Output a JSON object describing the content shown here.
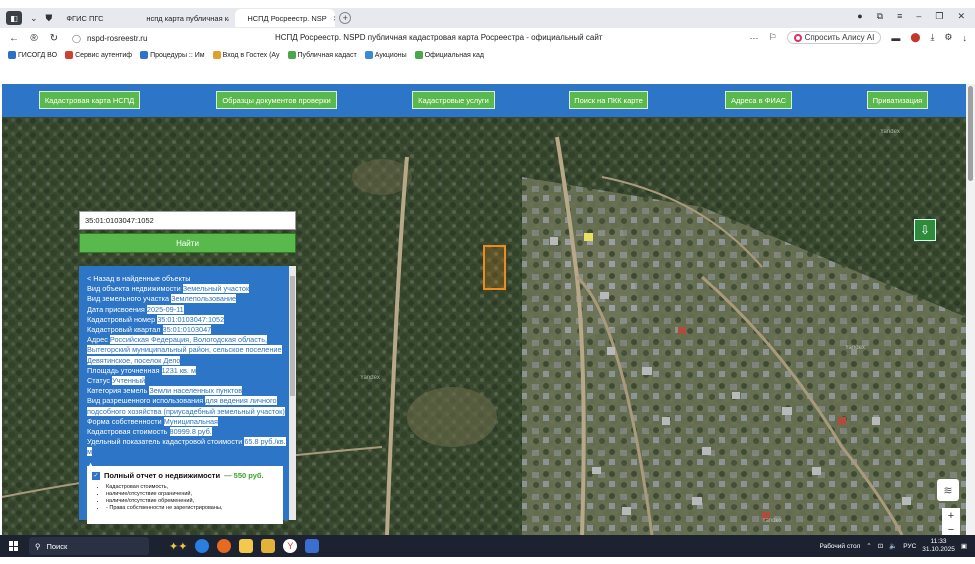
{
  "browser": {
    "tabs": [
      {
        "label": "ФГИС ПГС",
        "active": false
      },
      {
        "label": "нспд карта публичная кад",
        "active": false
      },
      {
        "label": "НСПД Росреестр. NSP",
        "active": true
      }
    ],
    "url": "nspd-rosreestr.ru",
    "page_title": "НСПД Росреестр. NSPD публичная кадастровая карта Росреестра - официальный сайт",
    "alice_label": "Спросить Алису AI"
  },
  "bookmarks": [
    {
      "label": "ГИСОГД ВО",
      "color": "#2d6fc8"
    },
    {
      "label": "Сервис аутентиф",
      "color": "#d04030"
    },
    {
      "label": "Процедуры :: Им",
      "color": "#2d75c6"
    },
    {
      "label": "Вход в Гостех (Ау",
      "color": "#e0a030"
    },
    {
      "label": "Публичная кадаст",
      "color": "#4aa84a"
    },
    {
      "label": "Аукционы",
      "color": "#3a8ad0"
    },
    {
      "label": "Официальная кад",
      "color": "#4aa84a"
    }
  ],
  "site_nav": [
    {
      "label": "Кадастровая карта НСПД"
    },
    {
      "label": "Образцы документов проверки"
    },
    {
      "label": "Кадастровые услуги"
    },
    {
      "label": "Поиск на ПКК карте"
    },
    {
      "label": "Адреса в ФИАС"
    },
    {
      "label": "Приватизация"
    }
  ],
  "search": {
    "value": "35:01:0103047:1052",
    "button_label": "Найти"
  },
  "details": {
    "back_link": "< Назад в найденные объекты",
    "rows": [
      {
        "key": "Вид объекта недвижимости",
        "value": "Земельный участок"
      },
      {
        "key": "Вид земельного участка",
        "value": "Землепользование"
      },
      {
        "key": "Дата присвоения",
        "value": "2025-09-11"
      },
      {
        "key": "Кадастровый номер",
        "value": "35:01:0103047:1052"
      },
      {
        "key": "Кадастровый квартал",
        "value": "35:01:0103047"
      },
      {
        "key": "Адрес",
        "value": "Российская Федерация, Вологодская область, Вытегорский муниципальный район, сельское поселение Девятинское, поселок Депо"
      },
      {
        "key": "Площадь уточненная",
        "value": "1231 кв. м"
      },
      {
        "key": "Статус",
        "value": "Учтенный"
      },
      {
        "key": "Категория земель",
        "value": "Земли населенных пунктов"
      },
      {
        "key": "Вид разрешенного использования",
        "value": "для ведения личного подсобного хозяйства (приусадебный земельный участок)"
      },
      {
        "key": "Форма собственности",
        "value": "Муниципальная"
      },
      {
        "key": "Кадастровая стоимость",
        "value": "80999.8 руб."
      },
      {
        "key": "Удельный показатель кадастровой стоимости",
        "value": "65.8 руб./кв. м"
      }
    ],
    "collapse_glyph": "▲"
  },
  "report": {
    "title": "Полный отчет о недвижимости",
    "price": "— 550 руб.",
    "items": [
      "Кадастровая стоимость,",
      "наличие/отсутствие ограничений,",
      "наличие/отсутствие обременений,",
      "- Права собственности не зарегистрированы,"
    ]
  },
  "map": {
    "labels": [
      "Yandex",
      "Yandex",
      "Yandex",
      "Yandex"
    ],
    "parcel_color": "#f08a1c",
    "zoom_in": "+",
    "zoom_out": "−"
  },
  "taskbar": {
    "search_label": "Поиск",
    "desktop_label": "Рабочий стол",
    "lang": "РУС",
    "time": "11:33",
    "date": "31.10.2025"
  }
}
